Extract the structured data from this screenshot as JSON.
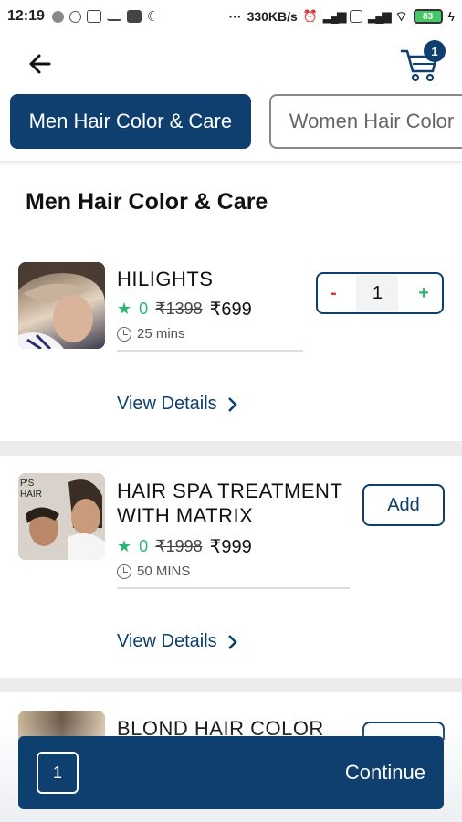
{
  "status_bar": {
    "time": "12:19",
    "network_speed": "330KB/s",
    "battery": "83"
  },
  "header": {
    "back_icon": "arrow-left-icon",
    "cart_icon": "cart-icon",
    "cart_count": "1"
  },
  "tabs": [
    {
      "label": "Men Hair Color & Care",
      "active": true
    },
    {
      "label": "Women Hair Color",
      "active": false
    }
  ],
  "section": {
    "title": "Men Hair Color & Care"
  },
  "services": [
    {
      "name": "HILIGHTS",
      "rating": "0",
      "mrp": "₹1398",
      "price": "₹699",
      "duration": "25 mins",
      "view_details": "View Details",
      "quantity": "1",
      "minus": "-",
      "plus": "+"
    },
    {
      "name_line1": "HAIR SPA TREATMENT",
      "name_line2": "WITH MATRIX",
      "rating": "0",
      "mrp": "₹1998",
      "price": "₹999",
      "duration": "50 MINS",
      "view_details": "View Details",
      "add_label": "Add"
    },
    {
      "name": "BLOND HAIR COLOR"
    }
  ],
  "bottom_bar": {
    "count": "1",
    "continue_label": "Continue"
  },
  "colors": {
    "primary": "#0e3f6e",
    "rating_green": "#2bb673",
    "minus_red": "#dd3333"
  }
}
